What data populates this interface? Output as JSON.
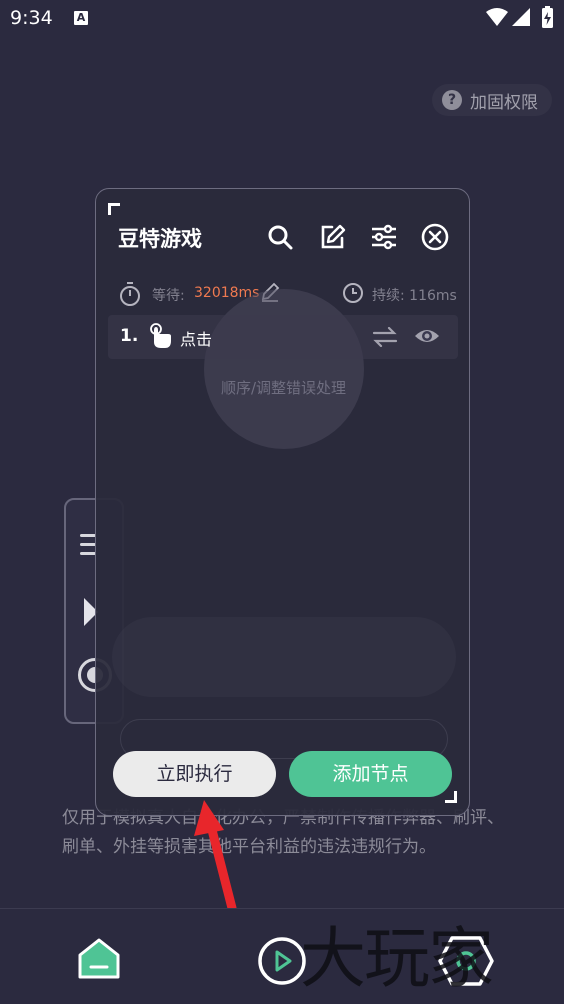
{
  "status_bar": {
    "time": "9:34",
    "notification_glyph": "A"
  },
  "permission": {
    "question_glyph": "?",
    "label": "加固权限"
  },
  "panel": {
    "title": "豆特游戏",
    "wait_label": "等待:",
    "wait_value": "32018ms",
    "duration_label": "持续: 116ms",
    "nodes": [
      {
        "index": "1.",
        "label": "点击"
      }
    ],
    "hint": "顺序/调整错误处理",
    "execute_label": "立即执行",
    "add_node_label": "添加节点"
  },
  "disclaimer": "仅用于模拟真人自动化办公，严禁制作传播作弊器、刷评、刷单、外挂等损害其他平台利益的违法违规行为。",
  "watermark": "大玩家",
  "colors": {
    "background": "#2b2a3f",
    "accent_green": "#4fc495",
    "wait_value": "#f07a50",
    "arrow": "#e8262b"
  }
}
